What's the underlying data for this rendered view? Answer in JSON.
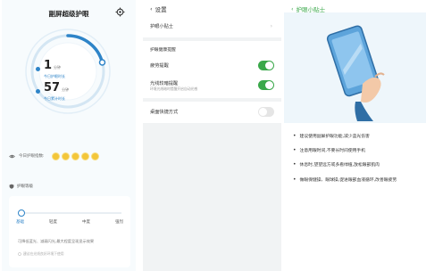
{
  "panel1": {
    "title": "副屏超级护眼",
    "stat1_value": "1",
    "stat1_unit": "分钟",
    "stat1_label": "今日护眼时长",
    "stat2_value": "57",
    "stat2_unit": "分钟",
    "stat2_label": "今日累计时长",
    "eye_index_label": "今日护眼指数:",
    "eye_index_score": 5,
    "mode_title": "护眼等级",
    "levels": [
      "基础",
      "轻度",
      "中度",
      "强烈"
    ],
    "selected_level": 0,
    "mode_desc": "可降低蓝光、减弱闪光,最大程度呈现显示效果",
    "mode_note": "建议在光线良好环境下使用",
    "accent": "#2e84c8"
  },
  "panel2": {
    "back_label": "设置",
    "tip_entry": "护眼小贴士",
    "section_title": "护眼健康提醒",
    "fatigue_label": "疲劳提醒",
    "fatigue_on": true,
    "light_label": "光线较暗提醒",
    "light_sub": "环境光线暗时提醒开启自动光感",
    "light_on": true,
    "shortcut_label": "桌面快捷方式",
    "shortcut_on": false
  },
  "panel3": {
    "back_label": "护眼小贴士",
    "tips": [
      "建议使用副屏护眼功能,减少蓝光伤害",
      "注意用眼时间,不要长时间使用手机",
      "休息时,望望远方或多看绿植,放松眼部肌肉",
      "做眼保健操、眼球操,促进眼部血液循环,改善眼疲劳"
    ]
  }
}
